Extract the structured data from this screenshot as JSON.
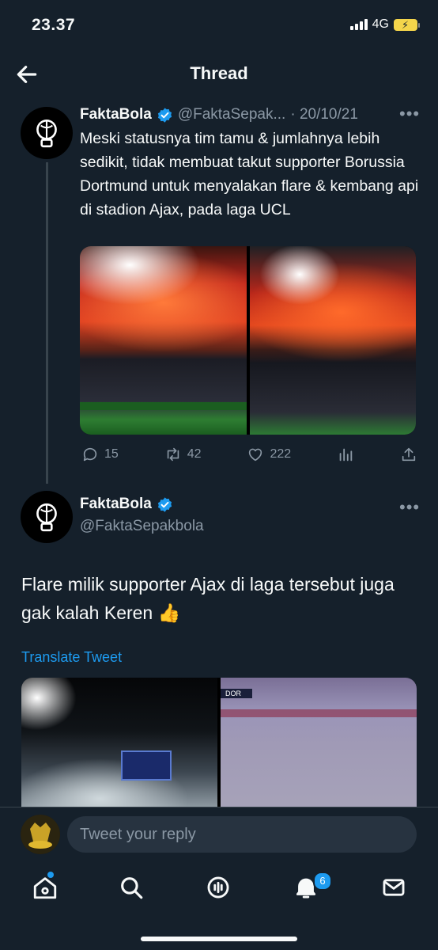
{
  "status_bar": {
    "time": "23.37",
    "network": "4G"
  },
  "header": {
    "title": "Thread"
  },
  "tweet1": {
    "name": "FaktaBola",
    "handle": "@FaktaSepak...",
    "date": "· 20/10/21",
    "text": "Meski statusnya tim tamu & jumlahnya lebih sedikit, tidak membuat takut supporter Borussia Dortmund untuk menyalakan flare & kembang api di stadion Ajax, pada laga UCL",
    "replies": "15",
    "retweets": "42",
    "likes": "222"
  },
  "tweet2": {
    "name": "FaktaBola",
    "handle": "@FaktaSepakbola",
    "text": "Flare milik supporter Ajax di laga tersebut juga gak kalah Keren 👍",
    "translate_label": "Translate Tweet",
    "image2_score_tag": "DOR"
  },
  "reply": {
    "placeholder": "Tweet your reply"
  },
  "tabbar": {
    "notifications_count": "6"
  },
  "colors": {
    "background": "#15202b",
    "accent": "#1d9bf0",
    "secondary_text": "#8b98a5"
  }
}
